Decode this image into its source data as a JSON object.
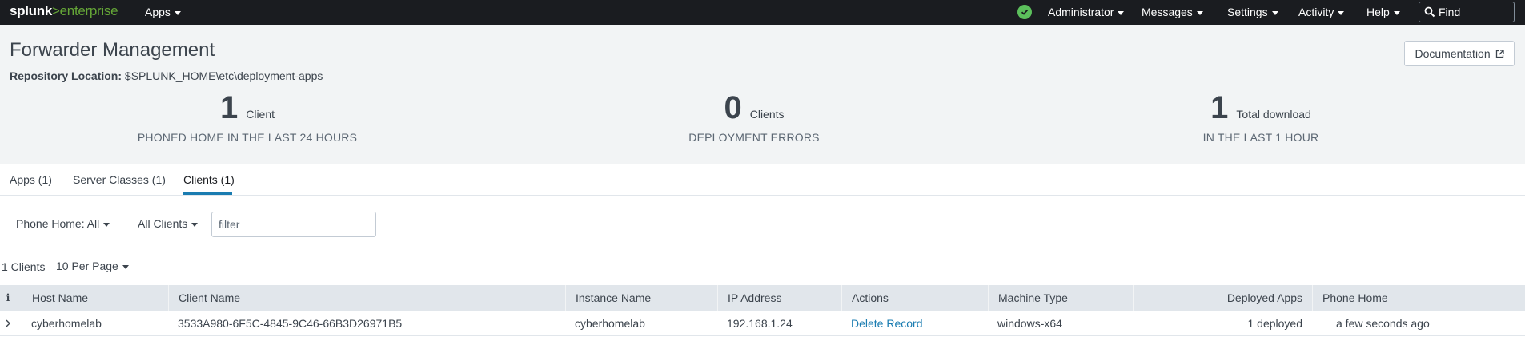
{
  "topnav": {
    "logo_splunk": "splunk",
    "logo_gt": ">",
    "logo_enterprise": "enterprise",
    "apps_label": "Apps",
    "user_label": "Administrator",
    "messages_label": "Messages",
    "settings_label": "Settings",
    "activity_label": "Activity",
    "help_label": "Help",
    "find_placeholder": "Find",
    "status_color": "#5cc05c"
  },
  "header": {
    "title": "Forwarder Management",
    "repo_label": "Repository Location:",
    "repo_value": "$SPLUNK_HOME\\etc\\deployment-apps",
    "doc_button": "Documentation"
  },
  "stats": [
    {
      "value": "1",
      "unit": "Client",
      "caption": "PHONED HOME IN THE LAST 24 HOURS"
    },
    {
      "value": "0",
      "unit": "Clients",
      "caption": "DEPLOYMENT ERRORS"
    },
    {
      "value": "1",
      "unit": "Total download",
      "caption": "IN THE LAST 1 HOUR"
    }
  ],
  "tabs": [
    {
      "label": "Apps (1)"
    },
    {
      "label": "Server Classes (1)"
    },
    {
      "label": "Clients (1)",
      "active": true
    }
  ],
  "filters": {
    "phone_home": "Phone Home: All",
    "client_scope": "All Clients",
    "filter_placeholder": "filter"
  },
  "list": {
    "count": "1 Clients",
    "per_page": "10 Per Page"
  },
  "table": {
    "info_icon": "i",
    "columns": [
      "Host Name",
      "Client Name",
      "Instance Name",
      "IP Address",
      "Actions",
      "Machine Type",
      "Deployed Apps",
      "Phone Home"
    ],
    "rows": [
      {
        "host_name": "cyberhomelab",
        "client_name": "3533A980-6F5C-4845-9C46-66B3D26971B5",
        "instance_name": "cyberhomelab",
        "ip_address": "192.168.1.24",
        "action": "Delete Record",
        "machine_type": "windows-x64",
        "deployed_apps": "1 deployed",
        "phone_home": "a few seconds ago"
      }
    ]
  },
  "colors": {
    "nav_bg": "#1a1c20",
    "brand_green": "#65a637",
    "link_blue": "#1a7cb1",
    "header_bg": "#f2f4f5",
    "table_header_bg": "#e1e6eb"
  }
}
